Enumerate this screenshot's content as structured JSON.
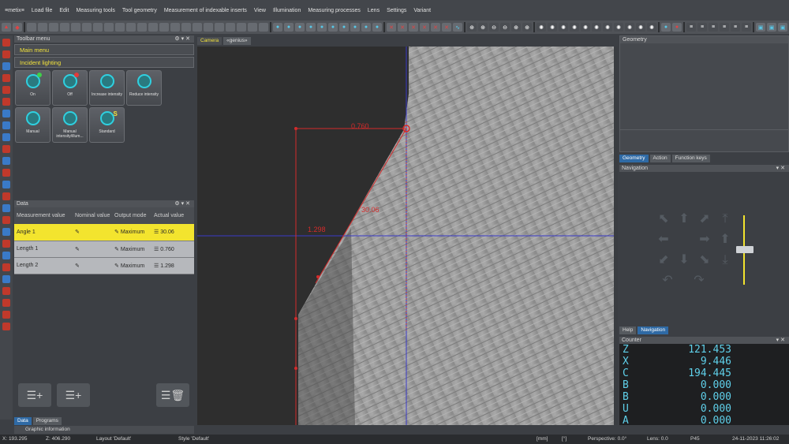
{
  "menu": [
    "≡metix≡",
    "Load file",
    "Edit",
    "Measuring tools",
    "Tool geometry",
    "Measurement of indexable inserts",
    "View",
    "Illumination",
    "Measuring processes",
    "Lens",
    "Settings",
    "Variant"
  ],
  "toolbar_menu": {
    "title": "Toolbar menu",
    "main_menu": "Main menu",
    "incident": "Incident lighting"
  },
  "light_buttons": [
    {
      "label": "On",
      "icon": "light-on-icon"
    },
    {
      "label": "Off",
      "icon": "light-off-icon"
    },
    {
      "label": "Increase intensity",
      "icon": "light-increase-icon"
    },
    {
      "label": "Reduce intensity",
      "icon": "light-reduce-icon"
    },
    {
      "label": "Manual",
      "icon": "light-manual-icon"
    },
    {
      "label": "Manual intensity/illum...",
      "icon": "light-manual-intensity-icon"
    },
    {
      "label": "Standard",
      "icon": "light-standard-icon"
    }
  ],
  "data_panel": {
    "title": "Data",
    "headers": [
      "Measurement value",
      "Nominal value",
      "Output mode",
      "Actual value"
    ],
    "rows": [
      {
        "name": "Angle 1",
        "mode": "Maximum",
        "actual": "30.06"
      },
      {
        "name": "Length 1",
        "mode": "Maximum",
        "actual": "0.760"
      },
      {
        "name": "Length 2",
        "mode": "Maximum",
        "actual": "1.298"
      }
    ]
  },
  "left_tabs": [
    "Data",
    "Programs"
  ],
  "graphic_info": "Graphic information",
  "camera_tabs": [
    "Camera",
    "«genius»"
  ],
  "overlay": {
    "length1": "0.760",
    "length2": "1.298",
    "angle": "30.06"
  },
  "geometry_title": "Geometry",
  "right_tabs": [
    "Geometry",
    "Action",
    "Function keys"
  ],
  "navigation_title": "Navigation",
  "mid_tabs": [
    "Help",
    "Navigation"
  ],
  "counter_title": "Counter",
  "counter": [
    {
      "axis": "Z",
      "value": "121.453"
    },
    {
      "axis": "X",
      "value": "9.446"
    },
    {
      "axis": "C",
      "value": "194.445"
    },
    {
      "axis": "B",
      "value": "0.000"
    },
    {
      "axis": "B",
      "value": "0.000"
    },
    {
      "axis": "U",
      "value": "0.000"
    },
    {
      "axis": "A",
      "value": "0.000"
    }
  ],
  "status": {
    "x": "X: 193.295",
    "z": "Z: 406.290",
    "layout": "Layout 'Default'",
    "style": "Style 'Default'",
    "unit": "[mm]",
    "deg": "[°]",
    "persp": "Perspective: 0.0°",
    "lens": "Lens: 0.0",
    "p45": "P45",
    "time": "24-11-2023 11:26:02"
  },
  "colors": {
    "accent": "#f3e42e",
    "tab_blue": "#2f6aa5",
    "cyan": "#5fd0ea",
    "measure_red": "#d42b2b",
    "crosshair": "#3a3ac8"
  }
}
